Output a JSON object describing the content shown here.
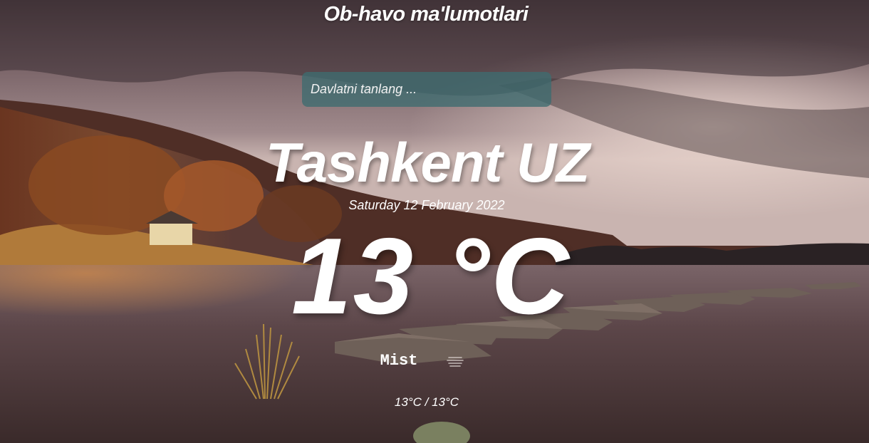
{
  "app": {
    "title": "Ob-havo ma'lumotlari"
  },
  "search": {
    "placeholder": "Davlatni tanlang ..."
  },
  "weather": {
    "location": "Tashkent UZ",
    "date": "Saturday 12 February 2022",
    "temperature": "13 °C",
    "condition": "Mist",
    "condition_icon": "mist-icon",
    "min_max": "13°C / 13°C"
  },
  "background": {
    "description_icon": "lake-landscape",
    "colors": {
      "sky": "#6b5a5f",
      "water": "#5a4446",
      "hills": "#5a2f22",
      "search_box": "#3e6c70"
    }
  }
}
